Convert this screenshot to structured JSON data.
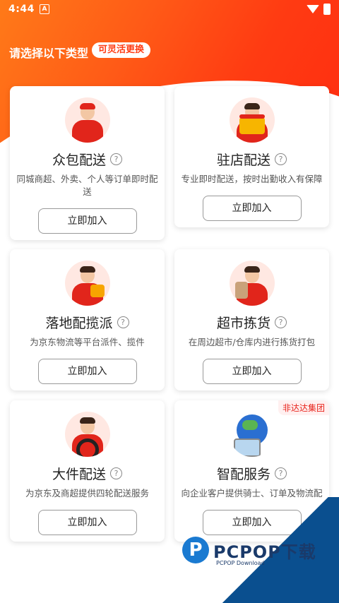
{
  "status_bar": {
    "time": "4:44",
    "app_icon": "A"
  },
  "header": {
    "title": "请选择以下类型",
    "badge": "可灵活更换"
  },
  "cards": [
    {
      "title": "众包配送",
      "desc": "同城商超、外卖、个人等订单即时配送",
      "button": "立即加入",
      "avatar": "courier-scooter-avatar"
    },
    {
      "title": "驻店配送",
      "desc": "专业即时配送，按时出勤收入有保障",
      "button": "立即加入",
      "avatar": "courier-store-avatar"
    },
    {
      "title": "落地配揽派",
      "desc": "为京东物流等平台派件、揽件",
      "button": "立即加入",
      "avatar": "courier-parcel-avatar"
    },
    {
      "title": "超市拣货",
      "desc": "在周边超市/仓库内进行拣货打包",
      "button": "立即加入",
      "avatar": "courier-grocery-avatar"
    },
    {
      "title": "大件配送",
      "desc": "为京东及商超提供四轮配送服务",
      "button": "立即加入",
      "avatar": "courier-driver-avatar"
    },
    {
      "title": "智配服务",
      "desc": "向企业客户提供骑士、订单及物流配",
      "button": "立即加入",
      "avatar": "globe-computer-avatar",
      "tag": "非达达集团"
    }
  ],
  "watermark": {
    "brand": "PCPOP下载",
    "sub": "PCPOP Download",
    "letter": "P"
  },
  "colors": {
    "accent": "#ff3b12",
    "brand_red": "#e1251b",
    "watermark_blue": "#0a4f8f"
  }
}
